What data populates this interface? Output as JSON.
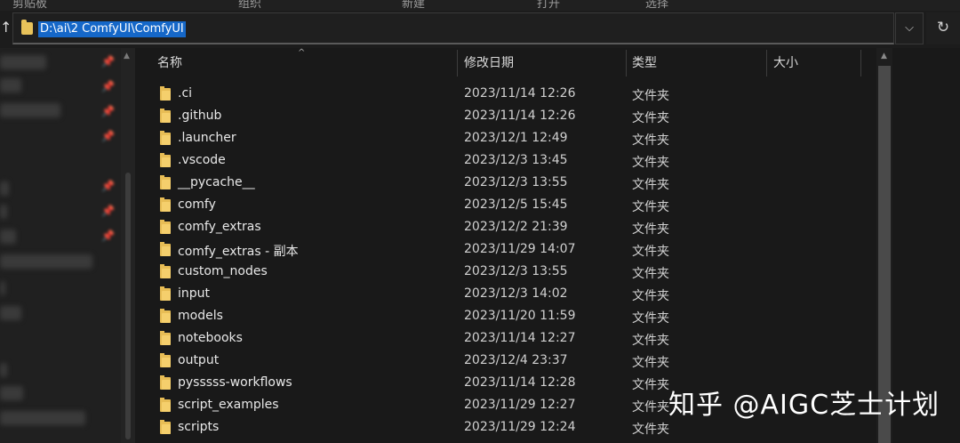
{
  "address": {
    "path": "D:\\ai\\2 ComfyUI\\ComfyUI",
    "dropdown_icon": "chevron-down-icon",
    "refresh_icon": "refresh-icon",
    "up_icon": "up-arrow-icon"
  },
  "ribbon": {
    "items": [
      "剪贴板",
      "组织",
      "新建",
      "打开",
      "选择"
    ]
  },
  "columns": {
    "name": "名称",
    "date": "修改日期",
    "type": "类型",
    "size": "大小"
  },
  "files": [
    {
      "name": ".ci",
      "date": "2023/11/14 12:26",
      "type": "文件夹"
    },
    {
      "name": ".github",
      "date": "2023/11/14 12:26",
      "type": "文件夹"
    },
    {
      "name": ".launcher",
      "date": "2023/12/1 12:49",
      "type": "文件夹"
    },
    {
      "name": ".vscode",
      "date": "2023/12/3 13:45",
      "type": "文件夹"
    },
    {
      "name": "__pycache__",
      "date": "2023/12/3 13:55",
      "type": "文件夹"
    },
    {
      "name": "comfy",
      "date": "2023/12/5 15:45",
      "type": "文件夹"
    },
    {
      "name": "comfy_extras",
      "date": "2023/12/2 21:39",
      "type": "文件夹"
    },
    {
      "name": "comfy_extras - 副本",
      "date": "2023/11/29 14:07",
      "type": "文件夹"
    },
    {
      "name": "custom_nodes",
      "date": "2023/12/3 13:55",
      "type": "文件夹"
    },
    {
      "name": "input",
      "date": "2023/12/3 14:02",
      "type": "文件夹"
    },
    {
      "name": "models",
      "date": "2023/11/20 11:59",
      "type": "文件夹"
    },
    {
      "name": "notebooks",
      "date": "2023/11/14 12:27",
      "type": "文件夹"
    },
    {
      "name": "output",
      "date": "2023/12/4 23:37",
      "type": "文件夹"
    },
    {
      "name": "pysssss-workflows",
      "date": "2023/11/14 12:28",
      "type": "文件夹"
    },
    {
      "name": "script_examples",
      "date": "2023/11/29 12:27",
      "type": "文件夹"
    },
    {
      "name": "scripts",
      "date": "2023/11/29 12:24",
      "type": "文件夹"
    }
  ],
  "watermark": "知乎 @AIGC芝士计划",
  "colors": {
    "background": "#191919",
    "selection": "#1567c8",
    "folder": "#e8bd55"
  }
}
